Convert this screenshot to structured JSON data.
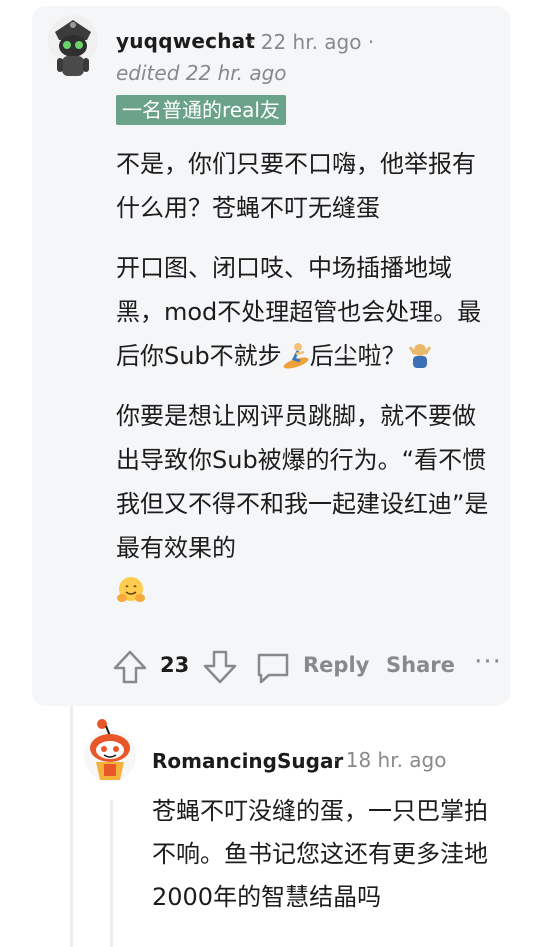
{
  "comment": {
    "username": "yuqqwechat",
    "meta": "· 22 hr. ago ·",
    "edited": "edited 22 hr. ago",
    "flair": "一名普通的real友",
    "paragraphs": [
      "不是，你们只要不口嗨，他举报有什么用？苍蝇不叮无缝蛋",
      "开口图、闭口吱、中场插播地域黑，mod不处理超管也会处理。最后你Sub不就步",
      "后尘啦？",
      "你要是想让网评员跳脚，就不要做出导致你Sub被爆的行为。“看不惯我但又不得不和我一起建设红迪”是最有效果的"
    ],
    "emojis": {
      "surfer": "surfer-emoji",
      "shrug": "shrug-emoji",
      "hug": "hugging-face-emoji"
    },
    "score": "23",
    "reply_label": "Reply",
    "share_label": "Share",
    "more_label": "···"
  },
  "reply": {
    "username": "RomancingSugar",
    "meta": "· 18 hr. ago",
    "body": "苍蝇不叮没缝的蛋，一只巴掌拍不响。鱼书记您这还有更多洼地2000年的智慧结晶吗"
  },
  "colors": {
    "card_bg": "#f5f6f8",
    "flair_bg": "#6aa389",
    "muted": "#878a8c",
    "text": "#1c1c1c",
    "thread_line": "#ededed"
  }
}
